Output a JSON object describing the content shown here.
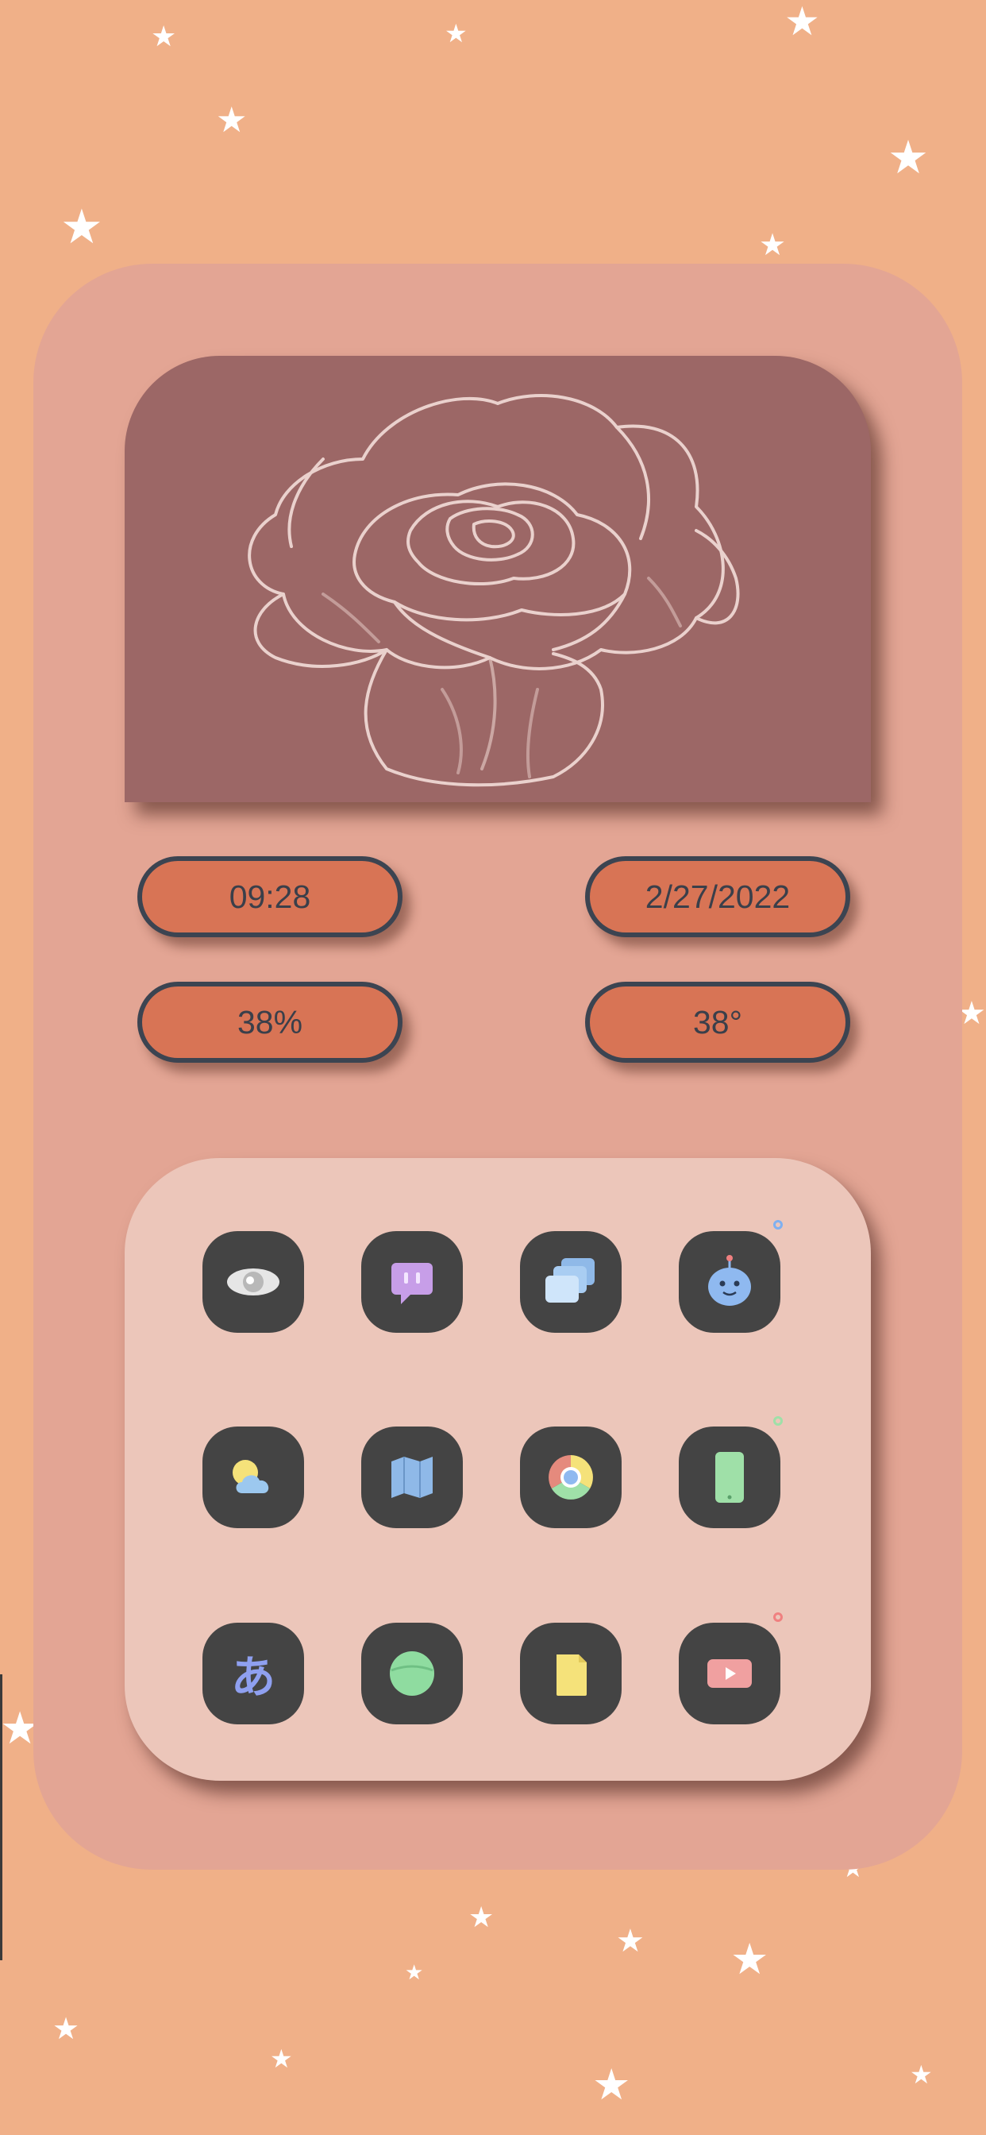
{
  "widgets": {
    "time": "09:28",
    "date": "2/27/2022",
    "battery": "38%",
    "temperature": "38°"
  },
  "icon_grid": {
    "rows": [
      [
        {
          "name": "eye-app-icon",
          "color": "#e8e8e8"
        },
        {
          "name": "chat-app-icon",
          "color": "#c79ee8"
        },
        {
          "name": "gallery-app-icon",
          "color": "#9cc8ef"
        },
        {
          "name": "robot-app-icon",
          "color": "#8fb9f0"
        }
      ],
      [
        {
          "name": "weather-app-icon",
          "color": "#9cc8ef"
        },
        {
          "name": "map-app-icon",
          "color": "#8fb9e8"
        },
        {
          "name": "chrome-app-icon",
          "color": "#e58a7d"
        },
        {
          "name": "phone-app-icon",
          "color": "#9fe0a8"
        }
      ],
      [
        {
          "name": "translate-app-icon",
          "color": "#8fa0f0",
          "glyph": "あ"
        },
        {
          "name": "green-circle-app-icon",
          "color": "#8fdca0"
        },
        {
          "name": "notes-app-icon",
          "color": "#f5e27a"
        },
        {
          "name": "video-app-icon",
          "color": "#f0a0a0"
        }
      ]
    ],
    "page_dots": [
      {
        "name": "page-dot-blue",
        "color": "#7fb0f0"
      },
      {
        "name": "page-dot-green",
        "color": "#9fe0a8"
      },
      {
        "name": "page-dot-red",
        "color": "#f08080"
      }
    ]
  }
}
